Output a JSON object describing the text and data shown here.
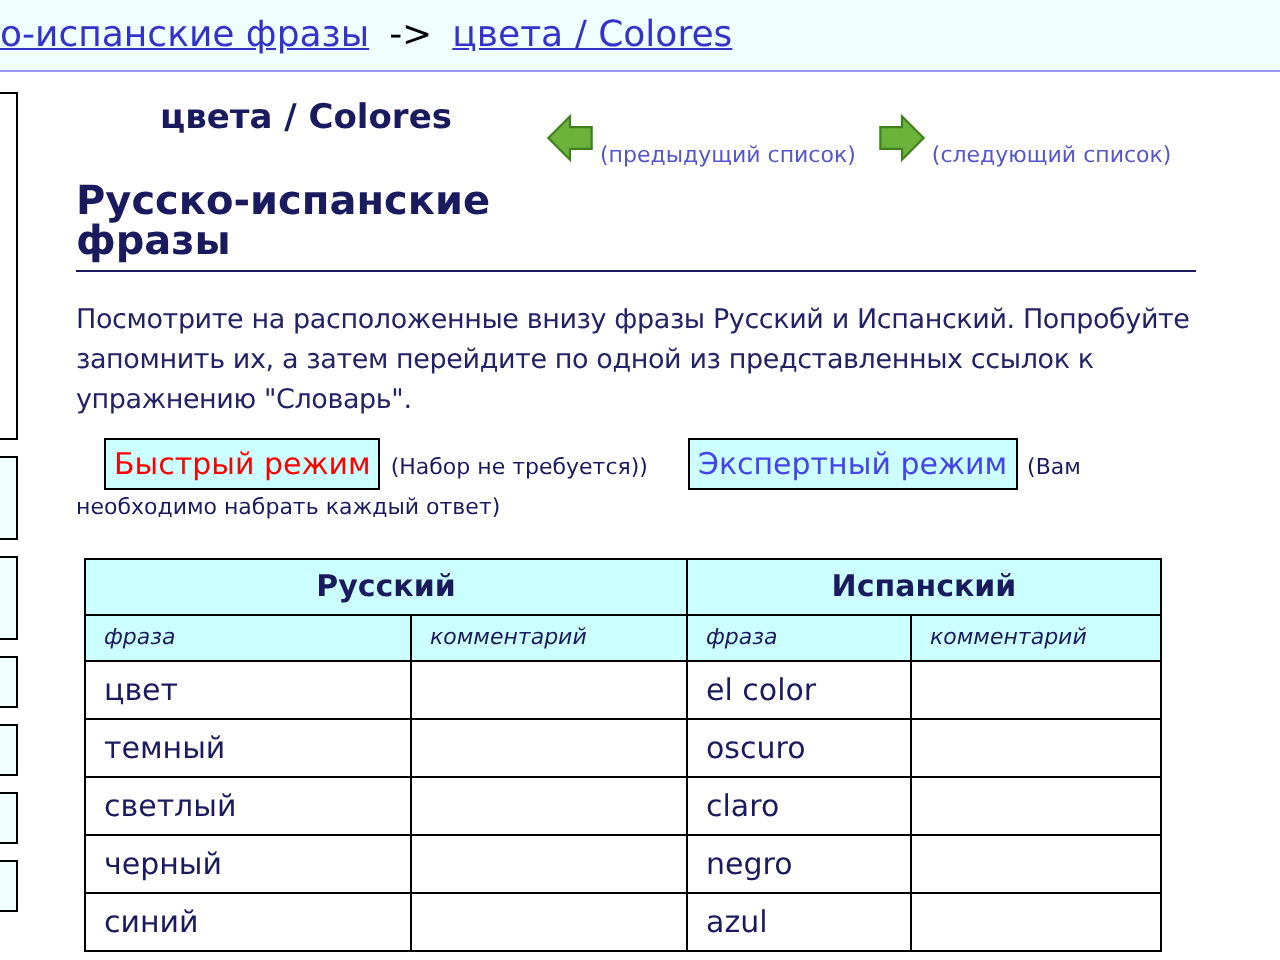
{
  "breadcrumb": {
    "links": [
      "о-испанские фразы",
      "цвета / Colores"
    ],
    "separator": "->"
  },
  "list_title": "цвета / Colores",
  "nav": {
    "previous": "(предыдущий список)",
    "next": "(следующий список)"
  },
  "heading": "Русско-испанские фразы",
  "intro": "Посмотрите на расположенные внизу фразы Русский и Испанский. Попробуйте запомнить их, а затем перейдите по одной из представленных ссылок к упражнению \"Словарь\".",
  "modes": [
    {
      "kind": "fast",
      "label": "Быстрый режим",
      "note": "(Набор не требуется))"
    },
    {
      "kind": "expert",
      "label": "Экспертный режим",
      "note": "(Вам",
      "note_continued": "необходимо набрать каждый ответ)"
    }
  ],
  "table": {
    "groups": [
      "Русский",
      "Испанский"
    ],
    "columns": [
      "фраза",
      "комментарий",
      "фраза",
      "комментарий"
    ],
    "rows": [
      [
        "цвет",
        "",
        "el color",
        ""
      ],
      [
        "темный",
        "",
        "oscuro",
        ""
      ],
      [
        "светлый",
        "",
        "claro",
        ""
      ],
      [
        "черный",
        "",
        "negro",
        ""
      ],
      [
        "синий",
        "",
        "azul",
        ""
      ]
    ]
  }
}
